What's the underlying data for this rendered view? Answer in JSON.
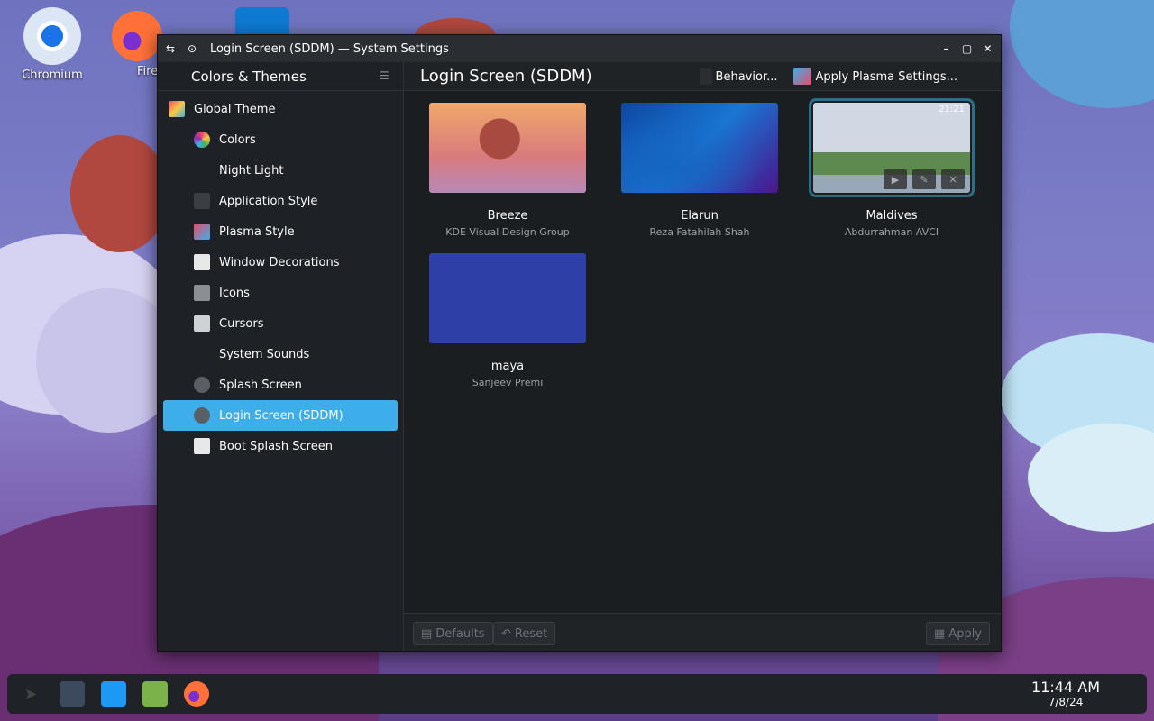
{
  "desktop": {
    "icons": [
      {
        "label": "Chromium"
      },
      {
        "label": "Fire"
      }
    ]
  },
  "window": {
    "title": "Login Screen (SDDM) — System Settings"
  },
  "sidebar": {
    "header": "Colors & Themes",
    "items": [
      {
        "label": "Global Theme",
        "icon": "global-theme-icon"
      },
      {
        "label": "Colors",
        "icon": "colors-icon"
      },
      {
        "label": "Night Light",
        "icon": "night-light-icon"
      },
      {
        "label": "Application Style",
        "icon": "application-style-icon"
      },
      {
        "label": "Plasma Style",
        "icon": "plasma-style-icon"
      },
      {
        "label": "Window Decorations",
        "icon": "window-decorations-icon"
      },
      {
        "label": "Icons",
        "icon": "icons-icon"
      },
      {
        "label": "Cursors",
        "icon": "cursors-icon"
      },
      {
        "label": "System Sounds",
        "icon": "system-sounds-icon"
      },
      {
        "label": "Splash Screen",
        "icon": "splash-screen-icon"
      },
      {
        "label": "Login Screen (SDDM)",
        "icon": "login-screen-icon"
      },
      {
        "label": "Boot Splash Screen",
        "icon": "boot-splash-icon"
      }
    ],
    "active_index": 10
  },
  "main": {
    "title": "Login Screen (SDDM)",
    "behavior_label": "Behavior...",
    "apply_plasma_label": "Apply Plasma Settings...",
    "themes": [
      {
        "name": "Breeze",
        "author": "KDE Visual Design Group"
      },
      {
        "name": "Elarun",
        "author": "Reza Fatahilah Shah"
      },
      {
        "name": "Maldives",
        "author": "Abdurrahman AVCI",
        "selected": true,
        "clock": "21:21"
      },
      {
        "name": "maya",
        "author": "Sanjeev Premi"
      }
    ]
  },
  "footer": {
    "defaults_label": "Defaults",
    "reset_label": "Reset",
    "apply_label": "Apply"
  },
  "taskbar": {
    "time": "11:44 AM",
    "date": "7/8/24"
  },
  "colors": {
    "accent": "#3daee9",
    "window_bg": "#1d2023",
    "selection_outline": "#2b6f87"
  }
}
